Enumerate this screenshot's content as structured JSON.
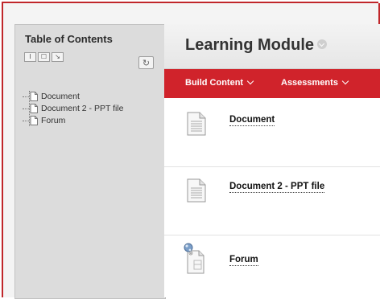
{
  "toc": {
    "title": "Table of Contents",
    "tools": [
      "I",
      "☐",
      "↘"
    ],
    "refresh_icon": "↻",
    "items": [
      {
        "label": "Document",
        "icon": "document-icon"
      },
      {
        "label": "Document 2 - PPT file",
        "icon": "document-icon"
      },
      {
        "label": "Forum",
        "icon": "document-icon"
      }
    ]
  },
  "module": {
    "title": "Learning Module"
  },
  "action_bar": {
    "build_content": "Build Content",
    "assessments": "Assessments",
    "color": "#d0232b"
  },
  "content_items": [
    {
      "title": "Document",
      "icon": "document-icon"
    },
    {
      "title": "Document 2 - PPT file",
      "icon": "document-icon"
    },
    {
      "title": "Forum",
      "icon": "forum-icon"
    }
  ]
}
